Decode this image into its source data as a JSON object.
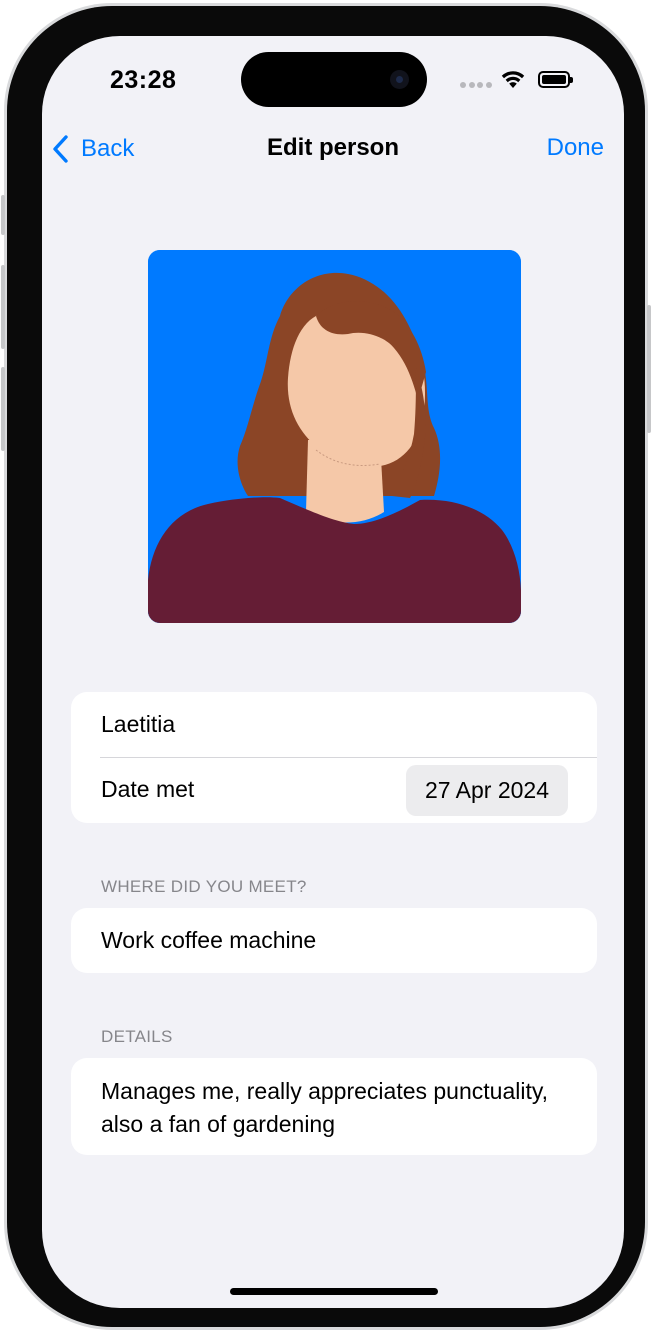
{
  "status_bar": {
    "time": "23:28",
    "icons": [
      "signal-dots-icon",
      "wifi-icon",
      "battery-icon"
    ]
  },
  "nav": {
    "back_label": "Back",
    "title": "Edit person",
    "done_label": "Done",
    "accent_color": "#007aff"
  },
  "avatar": {
    "background_color": "#007aff",
    "hair_color": "#8b4526",
    "skin_color": "#f5c8a8",
    "shirt_color": "#651d35"
  },
  "person": {
    "name": "Laetitia",
    "date_met_label": "Date met",
    "date_met_value": "27 Apr 2024"
  },
  "where_met": {
    "header": "WHERE DID YOU MEET?",
    "value": "Work coffee machine"
  },
  "details": {
    "header": "DETAILS",
    "value": "Manages me, really appreciates punctuality, also a fan of gardening"
  }
}
